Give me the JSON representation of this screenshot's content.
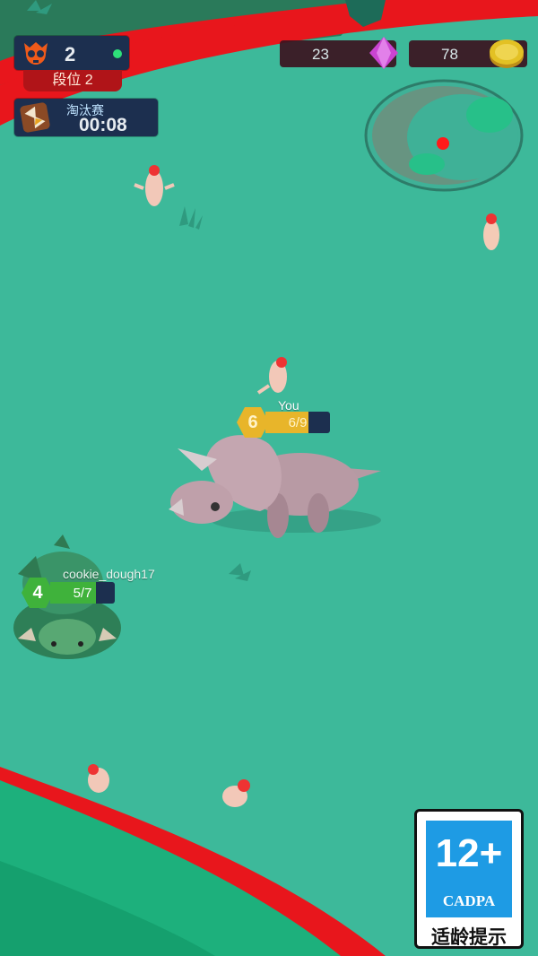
{
  "colors": {
    "ground": "#3db99a",
    "border": "#e8161c",
    "hud_panel": "#1c2f4f",
    "gem": "#d63bd6",
    "coin": "#f2c21b",
    "player_badge": "#e8b52a",
    "enemy_badge": "#3fb23b"
  },
  "hud": {
    "kills": {
      "icon": "skull-icon",
      "count": "2",
      "status_dot": "online-dot"
    },
    "rank_label": "段位 2",
    "timer": {
      "icon": "hourglass-icon",
      "mode": "淘汰赛",
      "time": "00:08"
    },
    "gems": {
      "icon": "gem-icon",
      "count": "23"
    },
    "coins": {
      "icon": "coin-icon",
      "count": "78"
    }
  },
  "minimap": {
    "icon": "minimap"
  },
  "player": {
    "name": "You",
    "level": "6",
    "progress_text": "6/9",
    "progress": 0.667
  },
  "enemy": {
    "name": "cookie_dough17",
    "level": "4",
    "progress_text": "5/7",
    "progress": 0.714
  },
  "age_rating": {
    "rating": "12+",
    "org": "CADPA",
    "caption": "适龄提示"
  }
}
